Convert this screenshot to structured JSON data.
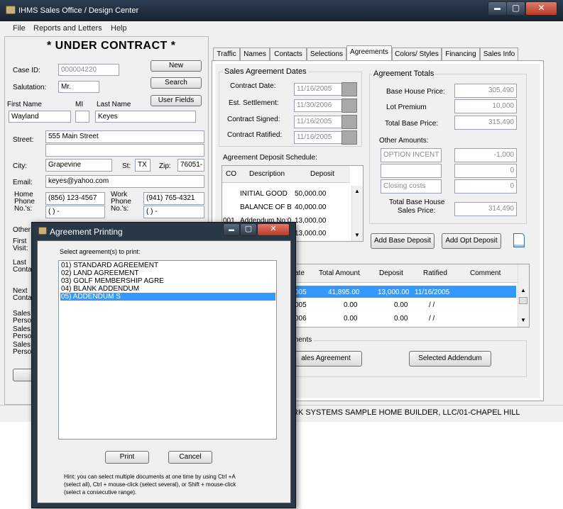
{
  "window": {
    "title": "IHMS Sales Office / Design Center",
    "min": "▬",
    "max": "▢",
    "close": "✕"
  },
  "menu": [
    "File",
    "Reports and Letters",
    "Help"
  ],
  "banner": "* UNDER CONTRACT *",
  "left": {
    "case_id_label": "Case ID:",
    "case_id": "000004220",
    "salutation_label": "Salutation:",
    "salutation": "Mr.",
    "first_name_label": "First Name",
    "mi_label": "MI",
    "last_name_label": "Last Name",
    "first_name": "Wayland",
    "mi": "",
    "last_name": "Keyes",
    "new_btn": "New",
    "search_btn": "Search",
    "user_fields_btn": "User Fields",
    "street_label": "Street:",
    "street": "555 Main Street",
    "street2": "",
    "city_label": "City:",
    "city": "Grapevine",
    "st_label": "St:",
    "st": "TX",
    "zip_label": "Zip:",
    "zip": "76051-",
    "email_label": "Email:",
    "email": "keyes@yahoo.com",
    "home_phone_label": "Home Phone No.'s:",
    "home1": "Home",
    "home2": "Phone",
    "home3": "No.'s:",
    "home_phone1": "(856) 123-4567",
    "home_phone2": "( )  -",
    "work1": "Work",
    "work2": "Phone",
    "work3": "No.'s:",
    "work_phone1": "(941) 765-4321",
    "work_phone2": "( )  -",
    "other": "Other",
    "first1": "First",
    "first2": "Visit:",
    "last1": "Last",
    "last2": "Conta",
    "next1": "Next",
    "next2": "Conta",
    "sales1a": "Sales",
    "sales1b": "Perso",
    "sales2a": "Sales",
    "sales2b": "Perso",
    "sales3a": "Sales",
    "sales3b": "Perso"
  },
  "tabs": [
    "Traffic",
    "Names",
    "Contacts",
    "Selections",
    "Agreements",
    "Colors/ Styles",
    "Financing",
    "Sales Info"
  ],
  "dates": {
    "group": "Sales Agreement Dates",
    "contract_date_label": "Contract Date:",
    "contract_date": "11/16/2005",
    "est_settlement_label": "Est. Settlement:",
    "est_settlement": "11/30/2006",
    "contract_signed_label": "Contract Signed:",
    "contract_signed": "11/16/2005",
    "contract_ratified_label": "Contract Ratified:",
    "contract_ratified": "11/16/2005"
  },
  "totals": {
    "group": "Agreement Totals",
    "base_house_label": "Base House Price:",
    "base_house": "305,490",
    "lot_premium_label": "Lot Premium",
    "lot_premium": "10,000",
    "total_base_label": "Total Base Price:",
    "total_base": "315,490",
    "other_amounts_label": "Other Amounts:",
    "other1_name": "OPTION INCENT",
    "other1_val": "-1,000",
    "other2_name": "",
    "other2_val": "0",
    "other3_name": "Closing costs",
    "other3_val": "0",
    "total_sales_label_1": "Total Base House",
    "total_sales_label_2": "Sales Price:",
    "total_sales": "314,490"
  },
  "deposit": {
    "title": "Agreement Deposit Schedule:",
    "headers": [
      "CO",
      "Description",
      "Deposit"
    ],
    "rows": [
      {
        "co": "",
        "desc": "INITIAL GOOD",
        "dep": "50,000.00"
      },
      {
        "co": "",
        "desc": "BALANCE OF B",
        "dep": "40,000.00"
      },
      {
        "co": "001",
        "desc": "Addendum No:0",
        "dep": "13,000.00"
      },
      {
        "co": "",
        "desc": "",
        "dep": "13,000.00"
      }
    ],
    "add_base": "Add Base Deposit",
    "add_opt": "Add Opt Deposit"
  },
  "agreements": {
    "headers": [
      "ate",
      "Total Amount",
      "Deposit",
      "Ratified",
      "Comment"
    ],
    "rows": [
      {
        "date": "005",
        "total": "41,895.00",
        "deposit": "13,000.00",
        "ratified": "11/16/2005",
        "comment": ""
      },
      {
        "date": "005",
        "total": "0.00",
        "deposit": "0.00",
        "ratified": "/  /",
        "comment": ""
      },
      {
        "date": "006",
        "total": "0.00",
        "deposit": "0.00",
        "ratified": "/  /",
        "comment": ""
      }
    ],
    "group": "ments",
    "sales_agreement_btn": "ales Agreement",
    "selected_addendum_btn": "Selected Addendum"
  },
  "status": "RK SYSTEMS SAMPLE HOME BUILDER, LLC/01-CHAPEL HILL",
  "dialog": {
    "title": "Agreement Printing",
    "prompt": "Select agreement(s) to print:",
    "items": [
      "01) STANDARD AGREEMENT",
      "02) LAND AGREEMENT",
      "03) GOLF MEMBERSHIP AGRE",
      "04) BLANK ADDENDUM",
      "05) ADDENDUM S"
    ],
    "selected_index": 4,
    "print_btn": "Print",
    "cancel_btn": "Cancel",
    "hint_1": "Hint: you can select multiple documents at one time by using Ctrl +A",
    "hint_2": "(select all), Ctrl + mouse-click (select several), or Shift + mouse-click",
    "hint_3": "(select a consecutive range)."
  },
  "colors": {
    "titlebar": "#1c2a3a",
    "selection": "#3399ff",
    "close_button": "#c0392b"
  }
}
